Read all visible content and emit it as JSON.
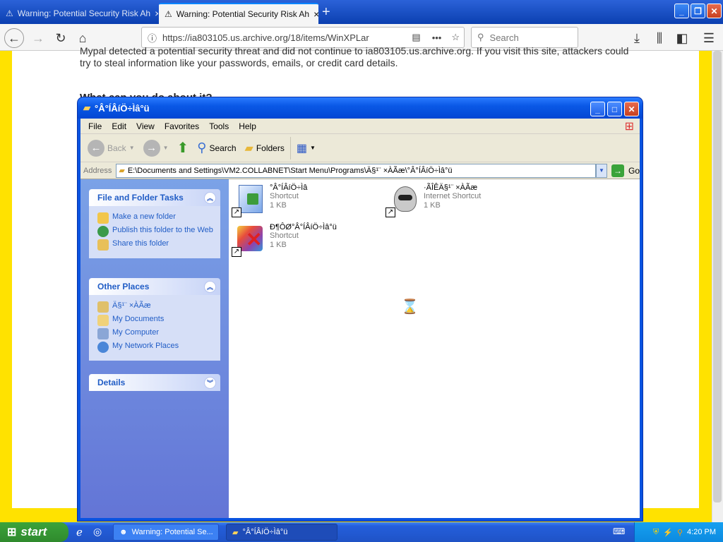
{
  "browser": {
    "tabs": [
      {
        "label": "Warning: Potential Security Risk Ah"
      },
      {
        "label": "Warning: Potential Security Risk Ah"
      }
    ],
    "url": "https://ia803105.us.archive.org/18/items/WinXPLar",
    "search_placeholder": "Search"
  },
  "page": {
    "warning_text": "Mypal detected a potential security threat and did not continue to ia803105.us.archive.org. If you visit this site, attackers could try to steal information like your passwords, emails, or credit card details.",
    "heading": "What can you do about it?"
  },
  "explorer": {
    "title": "°Â°ÍÂíÖ÷Ìâ°ü",
    "menus": [
      "File",
      "Edit",
      "View",
      "Favorites",
      "Tools",
      "Help"
    ],
    "toolbar": {
      "back": "Back",
      "search": "Search",
      "folders": "Folders"
    },
    "address_label": "Address",
    "address": "E:\\Documents and Settings\\VM2.COLLABNET\\Start Menu\\Programs\\Ä§¹¨ ×ÀÃæ\\°Â°ÍÂíÖ÷Ìâ°ü",
    "go": "Go",
    "tasks": {
      "title": "File and Folder Tasks",
      "items": [
        "Make a new folder",
        "Publish this folder to the Web",
        "Share this folder"
      ]
    },
    "places": {
      "title": "Other Places",
      "items": [
        "Ä§¹¨ ×ÀÃæ",
        "My Documents",
        "My Computer",
        "My Network Places"
      ]
    },
    "details": {
      "title": "Details"
    },
    "files": [
      {
        "name": "°Â°ÍÂíÖ÷Ìâ",
        "type": "Shortcut",
        "size": "1 KB"
      },
      {
        "name": "·ÃÎÊÄ§¹¨ ×ÀÃæ",
        "type": "Internet Shortcut",
        "size": "1 KB"
      },
      {
        "name": "Ð¶ÔØ°Â°ÍÂíÖ÷Ìâ°ü",
        "type": "Shortcut",
        "size": "1 KB"
      }
    ]
  },
  "taskbar": {
    "start": "start",
    "tasks": [
      {
        "label": "Warning: Potential Se..."
      },
      {
        "label": "°Â°ÍÂíÖ÷Ìâ°ü"
      }
    ],
    "clock": "4:20 PM"
  }
}
